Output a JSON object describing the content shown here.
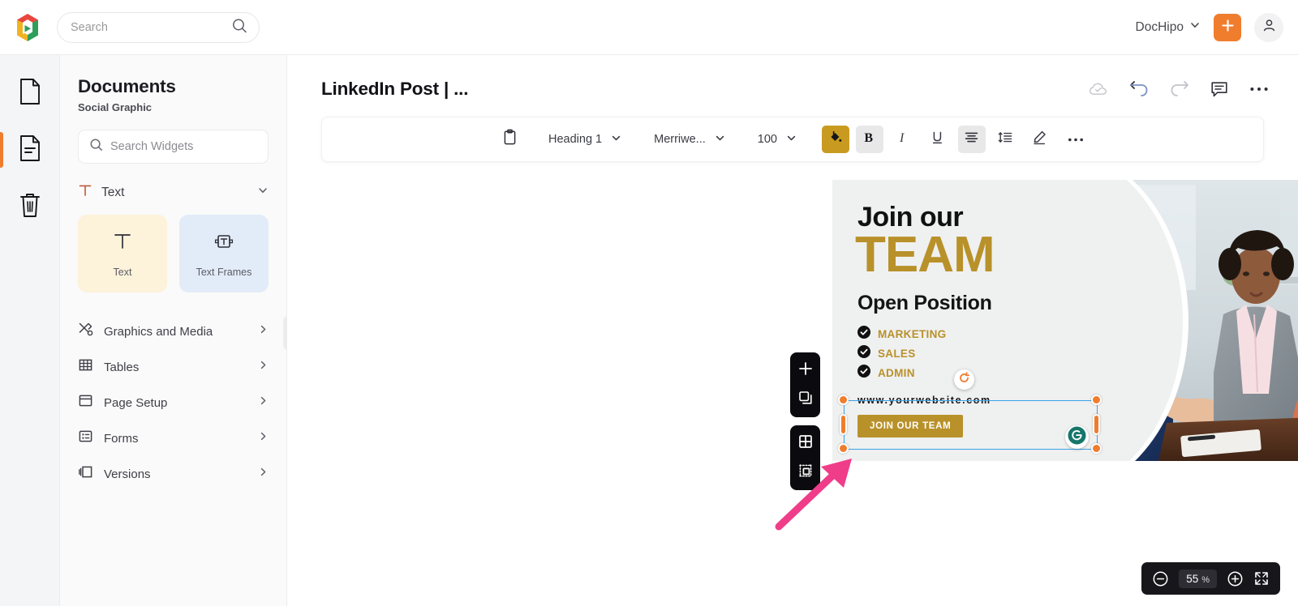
{
  "topbar": {
    "logo_icon": "dochipo-logo",
    "search": {
      "placeholder": "Search",
      "value": "",
      "icon": "search-icon"
    },
    "account_label": "DocHipo",
    "account_chevron_icon": "chevron-down-icon",
    "create_icon": "plus-icon",
    "avatar_icon": "user-avatar-icon",
    "accent_orange": "#f07d2e"
  },
  "rail": {
    "items": [
      {
        "name": "documents",
        "icon": "page-icon",
        "active": false
      },
      {
        "name": "pages",
        "icon": "page-lines-icon",
        "active": true
      },
      {
        "name": "trash",
        "icon": "trash-icon",
        "active": false
      }
    ]
  },
  "panel": {
    "title": "Documents",
    "subtitle": "Social Graphic",
    "search": {
      "placeholder": "Search Widgets",
      "value": "",
      "icon": "search-icon"
    },
    "section": {
      "label": "Text",
      "icon": "text-T-icon",
      "chevron_icon": "chevron-down-icon"
    },
    "cards": [
      {
        "label": "Text",
        "icon": "text-T-icon",
        "bg": "#fdf2da"
      },
      {
        "label": "Text Frames",
        "icon": "text-frame-icon",
        "bg": "#e2ecf8"
      }
    ],
    "menu": [
      {
        "label": "Graphics and Media",
        "icon": "graphics-media-icon",
        "chevron_icon": "chevron-right-icon"
      },
      {
        "label": "Tables",
        "icon": "table-icon",
        "chevron_icon": "chevron-right-icon"
      },
      {
        "label": "Page Setup",
        "icon": "page-setup-icon",
        "chevron_icon": "chevron-right-icon"
      },
      {
        "label": "Forms",
        "icon": "forms-icon",
        "chevron_icon": "chevron-right-icon"
      },
      {
        "label": "Versions",
        "icon": "versions-icon",
        "chevron_icon": "chevron-right-icon"
      }
    ],
    "collapse_icon": "chevron-left-icon"
  },
  "document": {
    "title": "LinkedIn Post | ...",
    "actions": [
      {
        "name": "cloud-saved",
        "icon": "cloud-check-icon"
      },
      {
        "name": "undo",
        "icon": "undo-icon"
      },
      {
        "name": "redo",
        "icon": "redo-icon"
      },
      {
        "name": "comments",
        "icon": "comment-icon"
      },
      {
        "name": "more",
        "icon": "ellipsis-icon"
      }
    ]
  },
  "text_toolbar": {
    "clipboard_icon": "clipboard-icon",
    "style": {
      "value": "Heading 1",
      "chevron_icon": "chevron-down-icon"
    },
    "font": {
      "value": "Merriwe...",
      "chevron_icon": "chevron-down-icon"
    },
    "size": {
      "value": "100",
      "chevron_icon": "chevron-down-icon"
    },
    "fill_color": {
      "icon": "paint-bucket-icon",
      "color": "#c89b20",
      "active": true
    },
    "bold": {
      "icon": "bold-icon",
      "label": "B",
      "active": true
    },
    "italic": {
      "icon": "italic-icon",
      "label": "I",
      "active": false
    },
    "underline": {
      "icon": "underline-icon",
      "label": "U",
      "active": false
    },
    "align": {
      "icon": "align-center-icon",
      "active": true
    },
    "line_height": {
      "icon": "line-spacing-icon",
      "active": false
    },
    "pen": {
      "icon": "pen-edit-icon",
      "active": false
    },
    "more": {
      "icon": "ellipsis-icon"
    }
  },
  "object_tools": {
    "group_a": [
      {
        "name": "add-element",
        "icon": "plus-icon"
      },
      {
        "name": "duplicate",
        "icon": "duplicate-icon"
      }
    ],
    "group_b": [
      {
        "name": "grid-layout",
        "icon": "grid-icon"
      },
      {
        "name": "crop-resize",
        "icon": "crop-icon"
      }
    ]
  },
  "selection": {
    "rotate_icon": "rotate-icon",
    "grammarly_icon": "grammarly-icon",
    "handle_color": "#f07d2e",
    "outline_color": "#38a3e8"
  },
  "design": {
    "headline_small": "Join our",
    "headline_large": "TEAM",
    "subheading": "Open Position",
    "positions": [
      "MARKETING",
      "SALES",
      "ADMIN"
    ],
    "website": "www.yourwebsite.com",
    "cta_label": "JOIN OUR TEAM",
    "gold": "#b8912a",
    "background": "#eff0f0",
    "check_icon": "check-circle-icon",
    "photo_alt": "business-handshake-photo"
  },
  "zoom_control": {
    "out_icon": "zoom-out-icon",
    "value": "55",
    "unit": "%",
    "in_icon": "zoom-in-icon",
    "fullscreen_icon": "fullscreen-icon"
  }
}
